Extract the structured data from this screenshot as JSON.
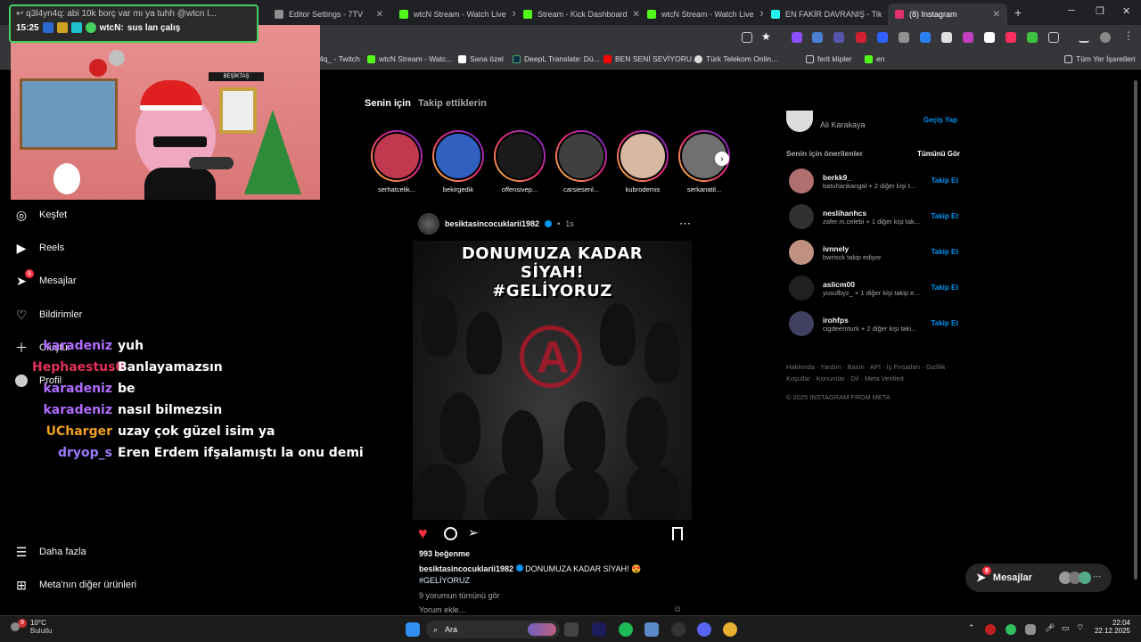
{
  "browser": {
    "tabs": [
      {
        "label": "Editor Settings - 7TV",
        "color": "#8f8f8f",
        "active": false
      },
      {
        "label": "wtcN Stream - Watch Live",
        "color": "#53fc18",
        "active": false
      },
      {
        "label": "Stream - Kick Dashboard",
        "color": "#53fc18",
        "active": false
      },
      {
        "label": "wtcN Stream - Watch Live",
        "color": "#53fc18",
        "active": false
      },
      {
        "label": "EN FAKİR DAVRANIŞ - Tik",
        "color": "#25f4ee",
        "active": false
      },
      {
        "label": "(8) Instagram",
        "color": "#e1306c",
        "active": true
      }
    ],
    "new_tab": "+",
    "bookmarks": [
      {
        "label": "4q_ - Twitch",
        "color": "#9146ff"
      },
      {
        "label": "wtcN Stream - Watc...",
        "color": "#53fc18"
      },
      {
        "label": "Sana özel",
        "color": "#ffffff"
      },
      {
        "label": "DeepL Translate: Dü...",
        "color": "#0f2b46"
      },
      {
        "label": "BEN SENİ SEVİYORU...",
        "color": "#ff0000"
      },
      {
        "label": "Türk Telekom Onlin...",
        "color": "#dddddd"
      },
      {
        "label": "ferit klipler",
        "color": "#cccccc"
      },
      {
        "label": "en",
        "color": "#53fc18"
      }
    ],
    "all_bookmarks": "Tüm Yer İşaretleri"
  },
  "stream": {
    "alert_text": "q3l4yn4q: abi 10k borç var mı ya tuhh @wtcn l...",
    "time": "15:25",
    "chat_user": "wtcN:",
    "chat_msg": "sus lan çalış",
    "sign": "BEŞİKTAŞ",
    "chat": [
      {
        "user": "karadeniz",
        "msg": "yuh",
        "color": "#b06cff"
      },
      {
        "user": "Hephaestus0",
        "msg": "Banlayamazsın",
        "color": "#e0305a"
      },
      {
        "user": "karadeniz",
        "msg": "be",
        "color": "#b06cff"
      },
      {
        "user": "karadeniz",
        "msg": "nasıl bilmezsin",
        "color": "#b06cff"
      },
      {
        "user": "UCharger",
        "msg": "uzay çok güzel isim ya",
        "color": "#f0a020"
      },
      {
        "user": "dryop_s",
        "msg": "Eren Erdem ifşalamıştı la onu demi",
        "color": "#9a7cff"
      }
    ]
  },
  "nav": {
    "explore": "Keşfet",
    "reels": "Reels",
    "messages": "Mesajlar",
    "messages_badge": "8",
    "notifications": "Bildirimler",
    "create": "Oluştur",
    "profile": "Profil",
    "more": "Daha fazla",
    "meta": "Meta'nın diğer ürünleri"
  },
  "feed": {
    "tab_for_you": "Senin için",
    "tab_following": "Takip ettiklerin",
    "stories": [
      {
        "name": "serhatcelik...",
        "color": "#c0394f"
      },
      {
        "name": "bekirgedik",
        "color": "#3060c0"
      },
      {
        "name": "offensivep...",
        "color": "#1a1a1a"
      },
      {
        "name": "carsiesenl...",
        "color": "#404040"
      },
      {
        "name": "kubrodemis",
        "color": "#d8b8a0"
      },
      {
        "name": "serkanatil...",
        "color": "#707070"
      }
    ],
    "post": {
      "user": "besiktasincocuklarii1982",
      "time": "1s",
      "image_text_1": "DONUMUZA KADAR",
      "image_text_2": "SİYAH!",
      "image_text_3": "#GELİYORUZ",
      "likes": "993 beğenme",
      "caption_user": "besiktasincocuklarii1982",
      "caption": "DONUMUZA KADAR SİYAH! 😍",
      "hashtag": "#GELİYORUZ",
      "comments": "9 yorumun tümünü gör",
      "add_comment": "Yorum ekle..."
    }
  },
  "sidebar": {
    "profile_name": "Ali Karakaya",
    "switch": "Geçiş Yap",
    "suggest_title": "Senin için önerilenler",
    "see_all": "Tümünü Gör",
    "suggestions": [
      {
        "name": "berkk9_",
        "sub": "batuhankangal + 2 diğer kişi t...",
        "action": "Takip Et",
        "color": "#b07070"
      },
      {
        "name": "neslihanhcs",
        "sub": "zafer.m.celebi + 1 diğer kişi tak...",
        "action": "Takip Et",
        "color": "#303030"
      },
      {
        "name": "ivnnely",
        "sub": "bwrisck takip ediyor",
        "action": "Takip Et",
        "color": "#c09080"
      },
      {
        "name": "aslicm00",
        "sub": "yusufbyz_ + 1 diğer kişi takip e...",
        "action": "Takip Et",
        "color": "#202020"
      },
      {
        "name": "irohfps",
        "sub": "cigdeemturk + 2 diğer kişi taki...",
        "action": "Takip Et",
        "color": "#404060"
      }
    ],
    "footer_1": "Hakkında · Yardım · Basın · API · İş Fırsatları · Gizlilik ·",
    "footer_2": "Koşullar · Konumlar · Dil · Meta Verified",
    "copyright": "© 2025 INSTAGRAM FROM META"
  },
  "messages_pill": {
    "label": "Mesajlar",
    "badge": "8"
  },
  "taskbar": {
    "weather_temp": "10°C",
    "weather_desc": "Bulutlu",
    "weather_badge": "9",
    "search": "Ara",
    "time": "22:04",
    "date": "22.12.2025"
  }
}
